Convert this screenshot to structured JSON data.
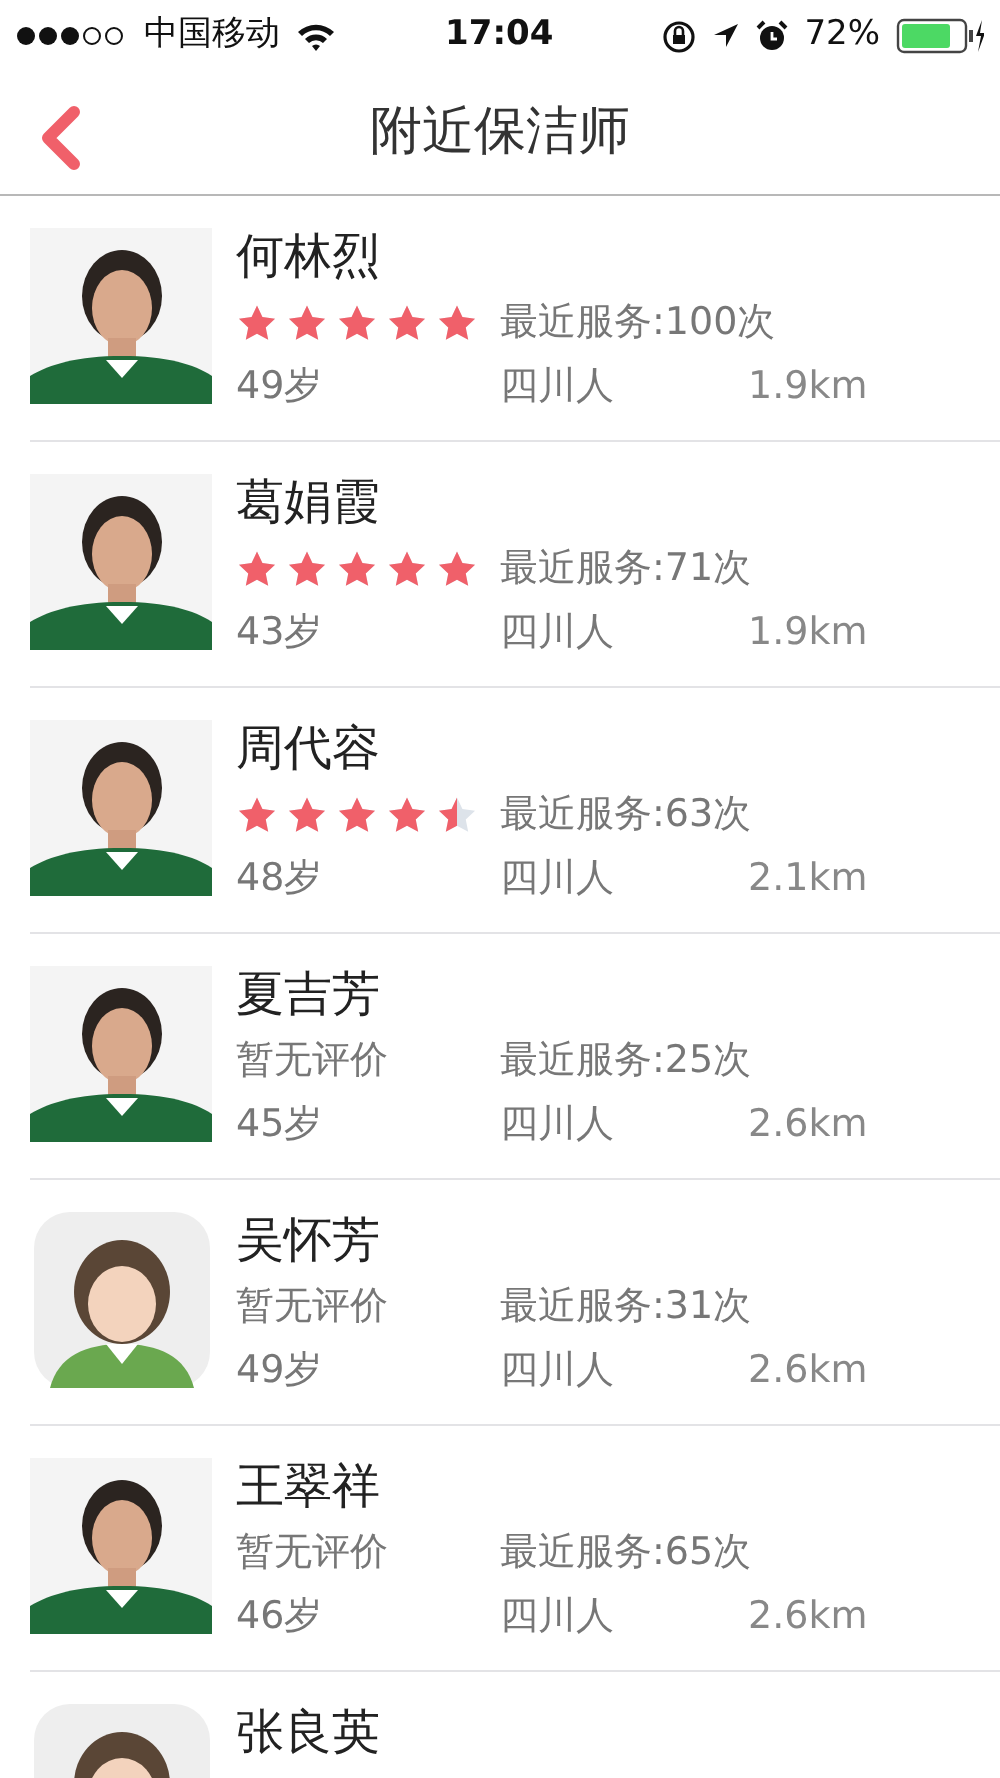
{
  "status_bar": {
    "carrier": "中国移动",
    "time": "17:04",
    "battery": "72%"
  },
  "nav": {
    "title": "附近保洁师"
  },
  "cleaners": [
    {
      "name": "何林烈",
      "stars": 5,
      "services": "最近服务:100次",
      "age": "49岁",
      "origin": "四川人",
      "distance": "1.9km"
    },
    {
      "name": "葛娟霞",
      "stars": 5,
      "services": "最近服务:71次",
      "age": "43岁",
      "origin": "四川人",
      "distance": "1.9km"
    },
    {
      "name": "周代容",
      "stars": 4.5,
      "services": "最近服务:63次",
      "age": "48岁",
      "origin": "四川人",
      "distance": "2.1km"
    },
    {
      "name": "夏吉芳",
      "rating_text": "暂无评价",
      "services": "最近服务:25次",
      "age": "45岁",
      "origin": "四川人",
      "distance": "2.6km"
    },
    {
      "name": "吴怀芳",
      "kind": "cartoon",
      "rating_text": "暂无评价",
      "services": "最近服务:31次",
      "age": "49岁",
      "origin": "四川人",
      "distance": "2.6km"
    },
    {
      "name": "王翠祥",
      "rating_text": "暂无评价",
      "services": "最近服务:65次",
      "age": "46岁",
      "origin": "四川人",
      "distance": "2.6km"
    },
    {
      "name": "张良英",
      "kind": "cartoon"
    }
  ]
}
